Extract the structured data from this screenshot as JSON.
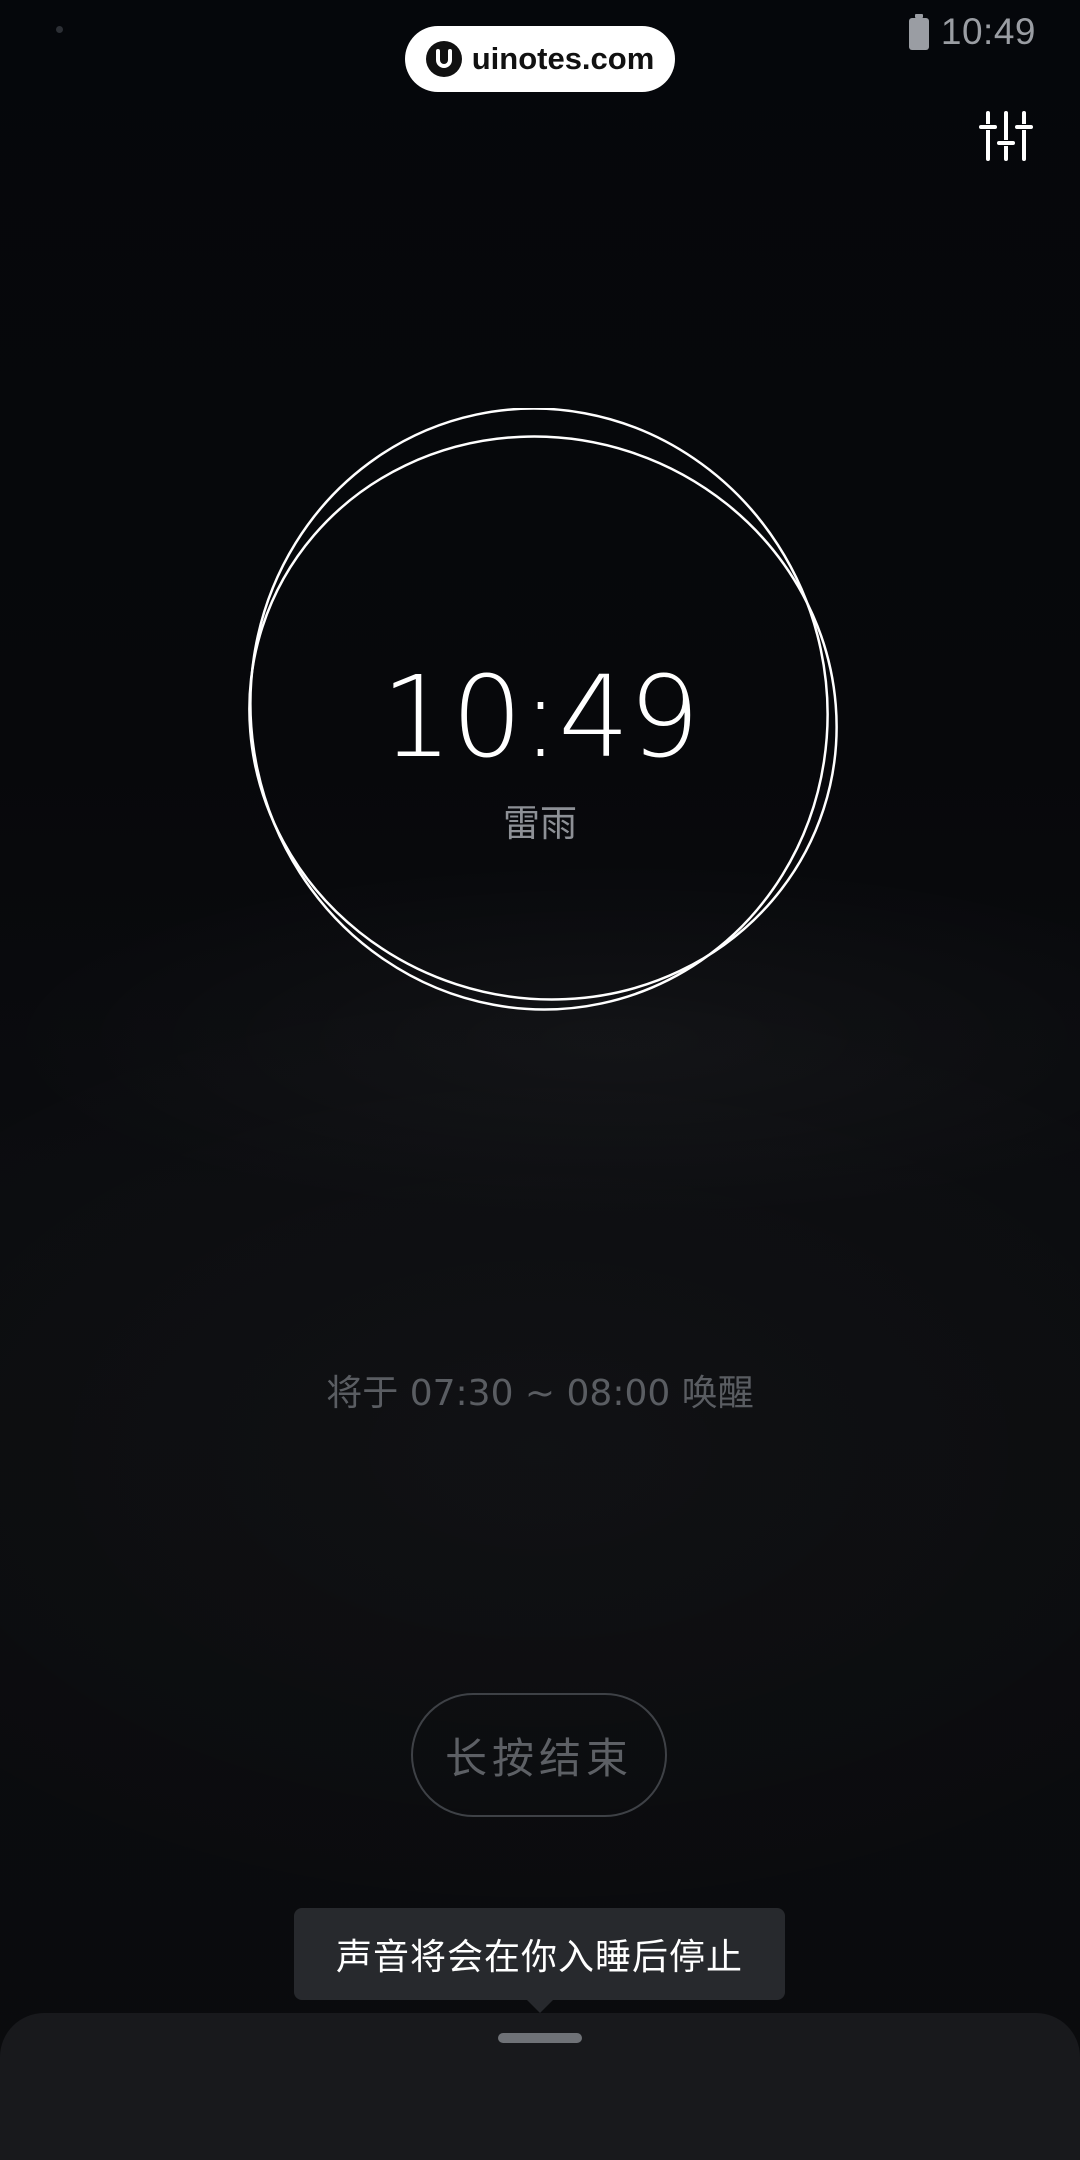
{
  "status_bar": {
    "time": "10:49",
    "battery_icon": "battery-full-icon"
  },
  "watermark": {
    "text": "uinotes.com",
    "logo_icon": "uinotes-logo-icon"
  },
  "toolbar": {
    "settings_icon": "sliders-icon"
  },
  "sleep": {
    "clock_time": "10:49",
    "sound_name": "雷雨",
    "wake_text": "将于 07:30 ~ 08:00 唤醒",
    "end_button_label": "长按结束"
  },
  "toast": {
    "message": "声音将会在你入睡后停止"
  },
  "colors": {
    "background": "#07080b",
    "ring": "#ffffff",
    "toast_bg": "#27292d",
    "sheet_bg": "#18191c"
  }
}
